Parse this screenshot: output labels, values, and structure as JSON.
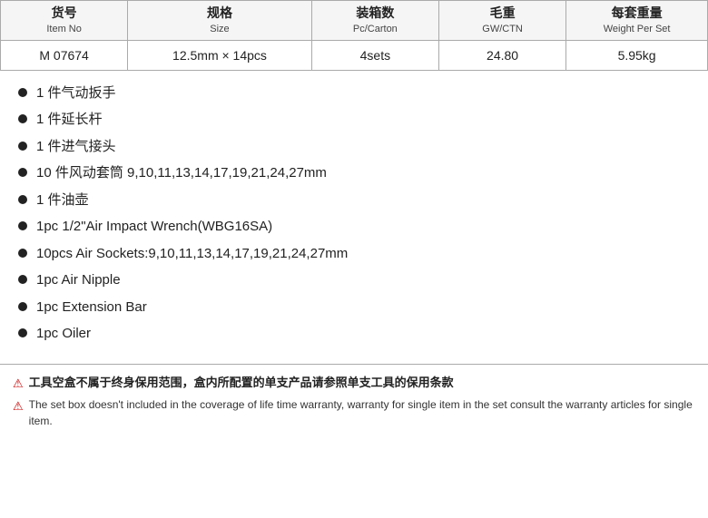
{
  "table": {
    "headers": [
      {
        "main": "货号",
        "sub": "Item No"
      },
      {
        "main": "规格",
        "sub": "Size"
      },
      {
        "main": "装箱数",
        "sub": "Pc/Carton"
      },
      {
        "main": "毛重",
        "sub": "GW/CTN"
      },
      {
        "main": "每套重量",
        "sub": "Weight Per Set"
      }
    ],
    "row": {
      "item_no": "M 07674",
      "size": "12.5mm × 14pcs",
      "pc_carton": "4sets",
      "gw_ctn": "24.80",
      "weight_per_set": "5.95kg"
    }
  },
  "items": [
    {
      "text": "1 件气动扳手"
    },
    {
      "text": "1 件延长杆"
    },
    {
      "text": "1 件进气接头"
    },
    {
      "text": "10 件风动套筒 9,10,11,13,14,17,19,21,24,27mm"
    },
    {
      "text": "1 件油壶"
    },
    {
      "text": "1pc      1/2\"Air Impact Wrench(WBG16SA)"
    },
    {
      "text": "10pcs   Air Sockets:9,10,11,13,14,17,19,21,24,27mm"
    },
    {
      "text": "1pc       Air Nipple"
    },
    {
      "text": "1pc     Extension Bar"
    },
    {
      "text": "1pc    Oiler"
    }
  ],
  "warnings": [
    {
      "cn": "工具空盒不属于终身保用范围，盒内所配置的单支产品请参照单支工具的保用条款",
      "en": "The set box doesn't included in the coverage of life time warranty, warranty for single item in the set consult the warranty articles for single item."
    }
  ]
}
